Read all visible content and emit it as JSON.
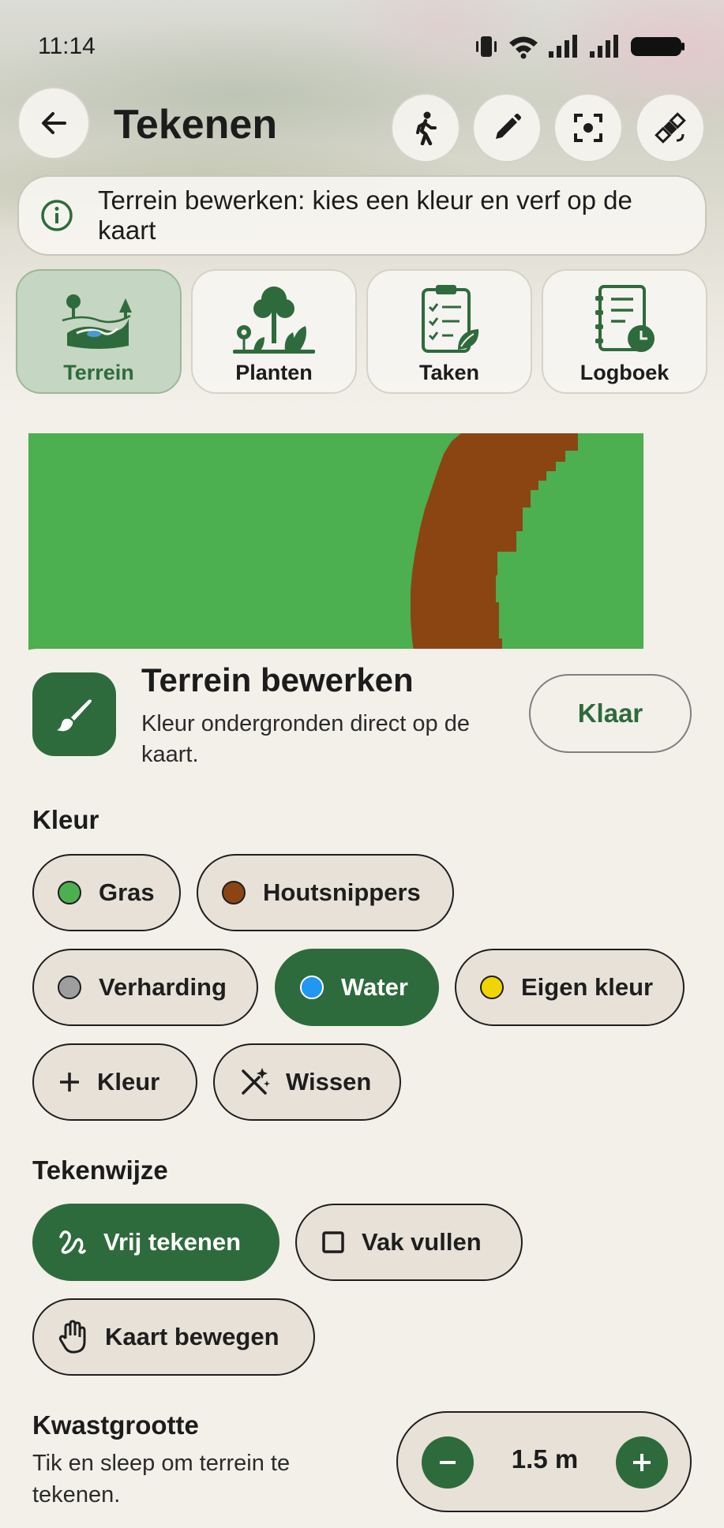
{
  "status_bar": {
    "time": "11:14"
  },
  "header": {
    "title": "Tekenen"
  },
  "banner": {
    "text": "Terrein bewerken: kies een kleur en verf op de kaart"
  },
  "categories": [
    {
      "label": "Terrein",
      "active": true
    },
    {
      "label": "Planten",
      "active": false
    },
    {
      "label": "Taken",
      "active": false
    },
    {
      "label": "Logboek",
      "active": false
    }
  ],
  "tool": {
    "title": "Terrein bewerken",
    "description": "Kleur ondergronden direct op de kaart.",
    "done_label": "Klaar"
  },
  "colors": {
    "heading": "Kleur",
    "items": [
      {
        "label": "Gras",
        "swatch": "#4caf50",
        "selected": false
      },
      {
        "label": "Houtsnippers",
        "swatch": "#8b4513",
        "selected": false
      },
      {
        "label": "Verharding",
        "swatch": "#9e9e9e",
        "selected": false
      },
      {
        "label": "Water",
        "swatch": "#2196f3",
        "selected": true
      },
      {
        "label": "Eigen kleur",
        "swatch": "#f1d400",
        "selected": false
      }
    ],
    "add_label": "Kleur",
    "erase_label": "Wissen"
  },
  "draw_mode": {
    "heading": "Tekenwijze",
    "free_label": "Vrij tekenen",
    "fill_label": "Vak vullen",
    "pan_label": "Kaart bewegen",
    "selected": "Vrij tekenen"
  },
  "brush": {
    "heading": "Kwastgrootte",
    "hint": "Tik en sleep om terrein te tekenen.",
    "value": "1.5 m"
  },
  "theme": {
    "accent": "#2e6b3c",
    "map_grass": "#4caf50",
    "map_path": "#8b4513"
  }
}
